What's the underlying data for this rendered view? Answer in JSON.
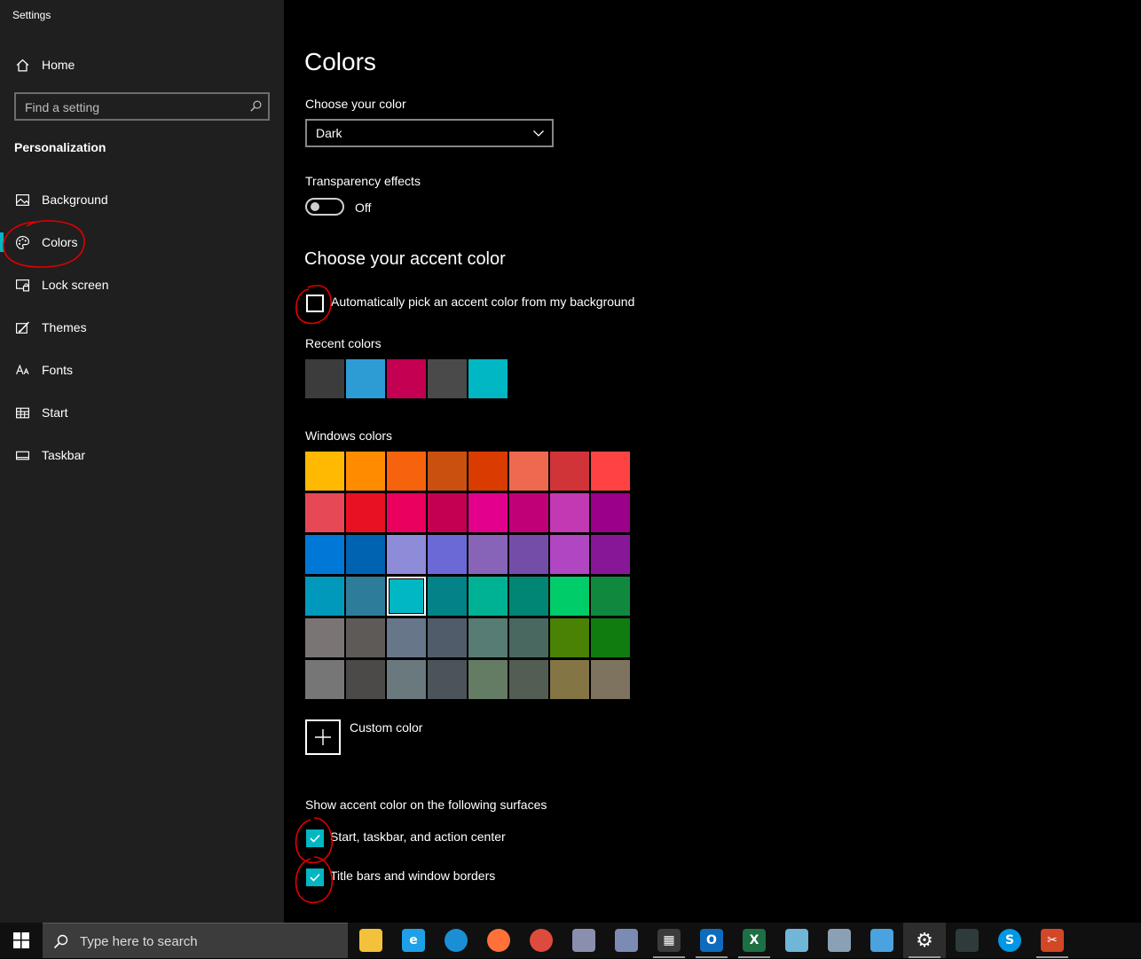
{
  "window": {
    "title": "Settings"
  },
  "sidebar": {
    "home_label": "Home",
    "search_placeholder": "Find a setting",
    "section_heading": "Personalization",
    "items": [
      {
        "label": "Background",
        "icon": "picture-icon"
      },
      {
        "label": "Colors",
        "icon": "palette-icon",
        "active": true
      },
      {
        "label": "Lock screen",
        "icon": "lock-screen-icon"
      },
      {
        "label": "Themes",
        "icon": "themes-brush-icon"
      },
      {
        "label": "Fonts",
        "icon": "fonts-icon"
      },
      {
        "label": "Start",
        "icon": "start-grid-icon"
      },
      {
        "label": "Taskbar",
        "icon": "taskbar-icon"
      }
    ]
  },
  "main": {
    "title": "Colors",
    "choose_color_label": "Choose your color",
    "choose_color_value": "Dark",
    "transparency_label": "Transparency effects",
    "transparency_state": "Off",
    "accent_heading": "Choose your accent color",
    "auto_pick_label": "Automatically pick an accent color from my background",
    "auto_pick_checked": false,
    "recent_colors_label": "Recent colors",
    "recent_colors": [
      "#3c3c3c",
      "#2d9cd5",
      "#c30052",
      "#4a4a4a",
      "#00b7c3"
    ],
    "windows_colors_label": "Windows colors",
    "windows_colors": [
      [
        "#ffb900",
        "#ff8c00",
        "#f7630c",
        "#ca5010",
        "#da3b01",
        "#ef6950",
        "#d13438",
        "#ff4343"
      ],
      [
        "#e74856",
        "#e81123",
        "#ea005e",
        "#c30052",
        "#e3008c",
        "#bf0077",
        "#c239b3",
        "#9a0089"
      ],
      [
        "#0078d7",
        "#0063b1",
        "#8e8cd8",
        "#6b69d6",
        "#8764b8",
        "#744da9",
        "#b146c2",
        "#881798"
      ],
      [
        "#0099bc",
        "#2d7d9a",
        "#00b7c3",
        "#038387",
        "#00b294",
        "#018574",
        "#00cc6a",
        "#10893e"
      ],
      [
        "#7a7574",
        "#5d5a58",
        "#68768a",
        "#515c6b",
        "#567c73",
        "#486860",
        "#498205",
        "#107c10"
      ],
      [
        "#767676",
        "#4c4a48",
        "#69797e",
        "#4a5459",
        "#647c64",
        "#525e54",
        "#847545",
        "#7e735f"
      ]
    ],
    "selected_color": "#00b7c3",
    "custom_color_label": "Custom color",
    "surfaces_label": "Show accent color on the following surfaces",
    "surface_start_label": "Start, taskbar, and action center",
    "surface_title_label": "Title bars and window borders",
    "surface_start_checked": true,
    "surface_title_checked": true,
    "accent_color": "#00b7c3",
    "annotation_color": "#e00000"
  },
  "taskbar": {
    "search_placeholder": "Type here to search",
    "apps": [
      {
        "name": "file-explorer-icon",
        "glyph": "",
        "color": "#f3c13a",
        "open": false
      },
      {
        "name": "internet-explorer-icon",
        "glyph": "e",
        "color": "#1ea0e8",
        "open": false
      },
      {
        "name": "edge-icon",
        "glyph": "",
        "color": "#1a8fd6",
        "open": false
      },
      {
        "name": "firefox-icon",
        "glyph": "",
        "color": "#ff7139",
        "open": false
      },
      {
        "name": "chrome-icon",
        "glyph": "",
        "color": "#dd4b3e",
        "open": false
      },
      {
        "name": "paint-icon",
        "glyph": "",
        "color": "#8a8fb0",
        "open": false
      },
      {
        "name": "paint-3d-icon",
        "glyph": "",
        "color": "#7b8bb3",
        "open": false
      },
      {
        "name": "calculator-icon",
        "glyph": "▦",
        "color": "#3c3c3c",
        "open": true
      },
      {
        "name": "outlook-icon",
        "glyph": "O",
        "color": "#0f6cbd",
        "open": true
      },
      {
        "name": "excel-icon",
        "glyph": "X",
        "color": "#1d7044",
        "open": true
      },
      {
        "name": "notepad-icon",
        "glyph": "",
        "color": "#6fb6d9",
        "open": false
      },
      {
        "name": "remote-desktop-icon",
        "glyph": "",
        "color": "#8aa0b5",
        "open": false
      },
      {
        "name": "control-panel-icon",
        "glyph": "",
        "color": "#4aa3df",
        "open": false
      },
      {
        "name": "settings-gear-icon",
        "glyph": "⚙",
        "color": "transparent",
        "open": true,
        "active": true
      },
      {
        "name": "vm-app-icon",
        "glyph": "",
        "color": "#2f3b3b",
        "open": false
      },
      {
        "name": "skype-icon",
        "glyph": "S",
        "color": "#0098e6",
        "open": false
      },
      {
        "name": "snipping-tool-icon",
        "glyph": "✂",
        "color": "#d24726",
        "open": true
      }
    ]
  }
}
